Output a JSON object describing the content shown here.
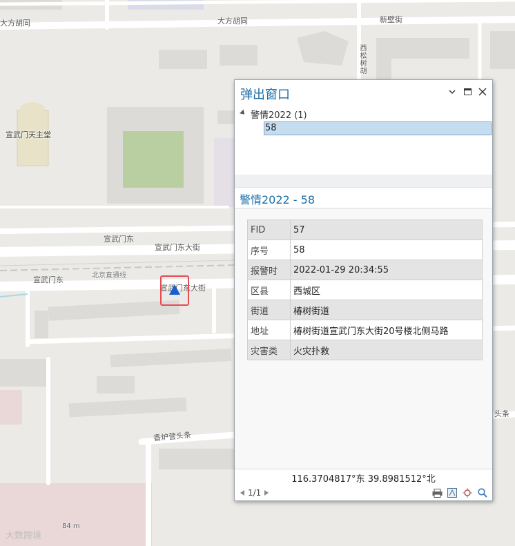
{
  "map": {
    "labels": {
      "dafang_1": "大方胡同",
      "dafang_2": "大方胡同",
      "xinbi": "新壁街",
      "xisong": "西松树胡",
      "church": "宣武门天主堂",
      "xuanwumen_dong": "宣武门东",
      "xuanwumen_dongdajie_1": "宣武门东大街",
      "beijing_line": "北京直通线",
      "xuanwumen_dong_2": "宣武门东",
      "xuanwumen_dongdajie_2": "宣武门东大街",
      "xianglu": "香炉营头条",
      "right_edge": "头条",
      "scale": "84 m"
    },
    "colors": {
      "land": "#ebeae6",
      "road": "#ffffff",
      "building": "#dcdbd7",
      "green": "#b9cfa1",
      "marker": "#1a5fd0",
      "highlight": "#e54b55"
    }
  },
  "popup": {
    "title": "弹出窗口",
    "icons": {
      "minimize": "chevron-down-icon",
      "maximize": "maximize-icon",
      "close": "close-icon"
    },
    "tree": {
      "layer": "警情2022 (1)",
      "feature": "58"
    },
    "section_title": "警情2022 - 58",
    "attributes": [
      {
        "key": "FID",
        "value": "57"
      },
      {
        "key": "序号",
        "value": "58"
      },
      {
        "key": "报警时",
        "value": "2022-01-29 20:34:55"
      },
      {
        "key": "区县",
        "value": "西城区"
      },
      {
        "key": "街道",
        "value": "椿树街道"
      },
      {
        "key": "地址",
        "value": "椿树街道宣武门东大街20号楼北侧马路"
      },
      {
        "key": "灾害类",
        "value": "火灾扑救"
      }
    ],
    "coordinates": "116.3704817°东 39.8981512°北",
    "pager": "1/1",
    "tool_icons": [
      "print-icon",
      "map-flash-icon",
      "pan-to-icon",
      "zoom-to-icon"
    ]
  },
  "watermark": "大数跨境"
}
